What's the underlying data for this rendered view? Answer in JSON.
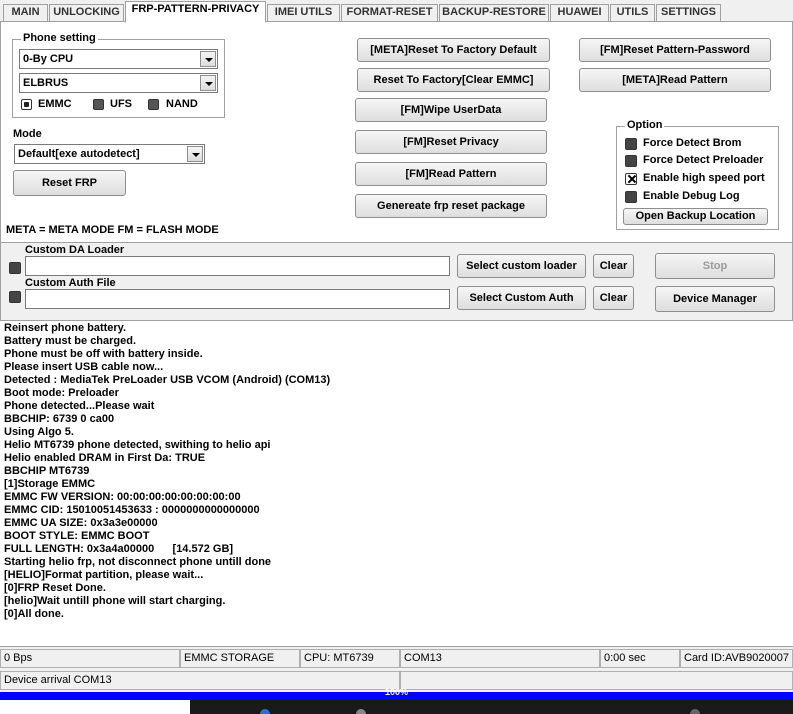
{
  "tabs": [
    {
      "label": "MAIN"
    },
    {
      "label": "UNLOCKING"
    },
    {
      "label": "FRP-PATTERN-PRIVACY"
    },
    {
      "label": "IMEI UTILS"
    },
    {
      "label": "FORMAT-RESET"
    },
    {
      "label": "BACKUP-RESTORE"
    },
    {
      "label": "HUAWEI"
    },
    {
      "label": "UTILS"
    },
    {
      "label": "SETTINGS"
    }
  ],
  "active_tab": "FRP-PATTERN-PRIVACY",
  "phone_setting": {
    "title": "Phone setting",
    "cpu_value": "0-By CPU",
    "model_value": "ELBRUS",
    "storage_options": [
      "EMMC",
      "UFS",
      "NAND"
    ],
    "storage_selected": "EMMC"
  },
  "mode": {
    "label": "Mode",
    "value": "Default[exe autodetect]"
  },
  "buttons": {
    "reset_frp": "Reset FRP",
    "meta_reset_factory": "[META]Reset To Factory Default",
    "reset_factory_emmc": "Reset To Factory[Clear EMMC]",
    "fm_wipe_userdata": "[FM]Wipe UserData",
    "fm_reset_privacy": "[FM]Reset Privacy",
    "fm_read_pattern": "[FM]Read Pattern",
    "generate_frp_package": "Genereate frp reset package",
    "fm_reset_pattern_password": "[FM]Reset Pattern-Password",
    "meta_read_pattern": "[META]Read Pattern",
    "open_backup_location": "Open Backup Location",
    "select_custom_loader": "Select custom loader",
    "clear_loader": "Clear",
    "select_custom_auth": "Select Custom Auth",
    "clear_auth": "Clear",
    "stop": "Stop",
    "device_manager": "Device Manager"
  },
  "option": {
    "title": "Option",
    "items": [
      {
        "label": "Force Detect Brom",
        "checked": false
      },
      {
        "label": "Force Detect Preloader",
        "checked": false
      },
      {
        "label": "Enable high speed port",
        "checked": true
      },
      {
        "label": "Enable Debug Log",
        "checked": false
      }
    ]
  },
  "legend_note": "META = META MODE     FM = FLASH MODE",
  "custom_da_loader": {
    "label": "Custom DA Loader",
    "value": ""
  },
  "custom_auth_file": {
    "label": "Custom Auth File",
    "value": ""
  },
  "log": [
    "Reinsert phone battery.",
    "Battery must be charged.",
    "Phone must be off with battery inside.",
    "Please insert USB cable now...",
    "Detected : MediaTek PreLoader USB VCOM (Android) (COM13)",
    "Boot mode: Preloader",
    "Phone detected...Please wait",
    "BBCHIP: 6739 0 ca00",
    "Using Algo 5.",
    "Helio MT6739 phone detected, swithing to helio api",
    "Helio enabled DRAM in First Da: TRUE",
    "BBCHIP MT6739",
    "[1]Storage EMMC",
    "EMMC FW VERSION: 00:00:00:00:00:00:00:00",
    "EMMC CID: 15010051453633 : 0000000000000000",
    "EMMC UA SIZE: 0x3a3e00000",
    "BOOT STYLE: EMMC BOOT",
    "FULL LENGTH: 0x3a4a00000      [14.572 GB]",
    "Starting helio frp, not disconnect phone untill done",
    "[HELIO]Format partition, please wait...",
    "[0]FRP Reset Done.",
    "[helio]Wait untill phone will start charging.",
    "[0]All done."
  ],
  "status_bar": {
    "speed": "0 Bps",
    "storage": "EMMC STORAGE",
    "cpu": "CPU: MT6739",
    "port": "COM13",
    "time": "0:00 sec",
    "card_id": "Card ID:AVB9020007"
  },
  "status_message": "Device arrival COM13",
  "progress": {
    "text": "100%",
    "value": 1.0
  },
  "colors": {
    "progress_fill": "#0000ff",
    "panel_bg": "#ffffff",
    "window_bg": "#f0f0f0"
  }
}
